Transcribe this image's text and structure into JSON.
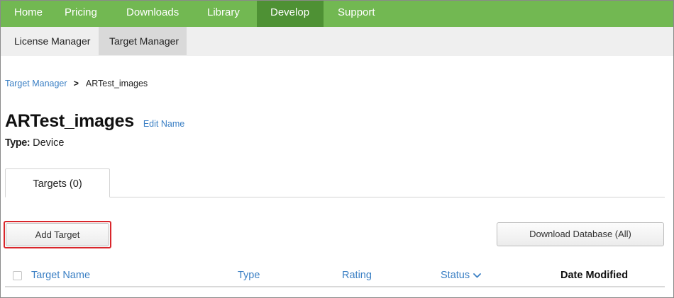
{
  "topnav": {
    "items": [
      {
        "label": "Home"
      },
      {
        "label": "Pricing"
      },
      {
        "label": "Downloads"
      },
      {
        "label": "Library"
      },
      {
        "label": "Develop"
      },
      {
        "label": "Support"
      }
    ],
    "active": "Develop"
  },
  "subnav": {
    "items": [
      {
        "label": "License Manager"
      },
      {
        "label": "Target Manager"
      }
    ],
    "active": "Target Manager"
  },
  "breadcrumb": {
    "root": "Target Manager",
    "separator": ">",
    "current": "ARTest_images"
  },
  "page": {
    "title": "ARTest_images",
    "edit_link": "Edit Name",
    "type_label": "Type:",
    "type_value": "Device"
  },
  "tabs": [
    {
      "label": "Targets (0)"
    }
  ],
  "actions": {
    "add_target": "Add Target",
    "download_database": "Download Database (All)"
  },
  "table": {
    "columns": [
      {
        "label": "Target Name"
      },
      {
        "label": "Type"
      },
      {
        "label": "Rating"
      },
      {
        "label": "Status"
      },
      {
        "label": "Date Modified"
      }
    ],
    "status_icon": "chevron-down-icon"
  },
  "colors": {
    "nav_green": "#72b852",
    "nav_active": "#4e9134",
    "link_blue": "#3a7fc4",
    "highlight_red": "#d9262b"
  }
}
